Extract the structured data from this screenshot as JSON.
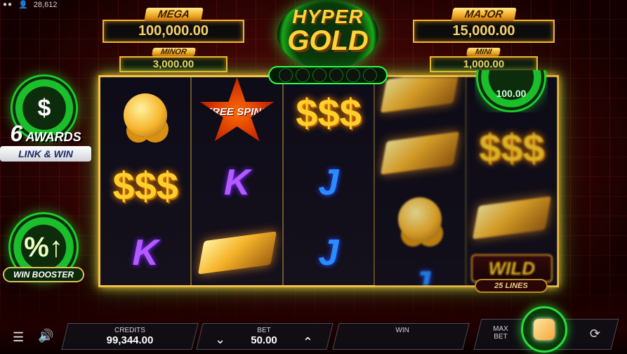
{
  "status": {
    "balance_count": "28,612"
  },
  "jackpots": {
    "mega": {
      "label": "MEGA",
      "value": "100,000.00"
    },
    "minor": {
      "label": "MINOR",
      "value": "3,000.00"
    },
    "major": {
      "label": "MAJOR",
      "value": "15,000.00"
    },
    "mini": {
      "label": "MINI",
      "value": "1,000.00"
    }
  },
  "logo": {
    "line1": "HYPER",
    "line2": "GOLD"
  },
  "left": {
    "awards_count": "6",
    "awards_label": "AWARDS",
    "link_win": "LINK & WIN",
    "win_booster": "WIN BOOSTER"
  },
  "reels": {
    "free_spins": "FREE SPINS",
    "wild": "WILD",
    "lines": "25 LINES",
    "partial_value": "100.00"
  },
  "bottom": {
    "credits_label": "CREDITS",
    "credits_value": "99,344.00",
    "bet_label": "BET",
    "bet_value": "50.00",
    "win_label": "WIN",
    "win_value": "",
    "max_bet": "MAX BET"
  },
  "colors": {
    "accent_green": "#2bdc3b",
    "gold": "#f5b52a",
    "bg_red": "#3a0505"
  },
  "icons": [
    "menu-icon",
    "sound-icon",
    "chevron-down-icon",
    "chevron-up-icon",
    "autoplay-icon",
    "user-icon"
  ]
}
